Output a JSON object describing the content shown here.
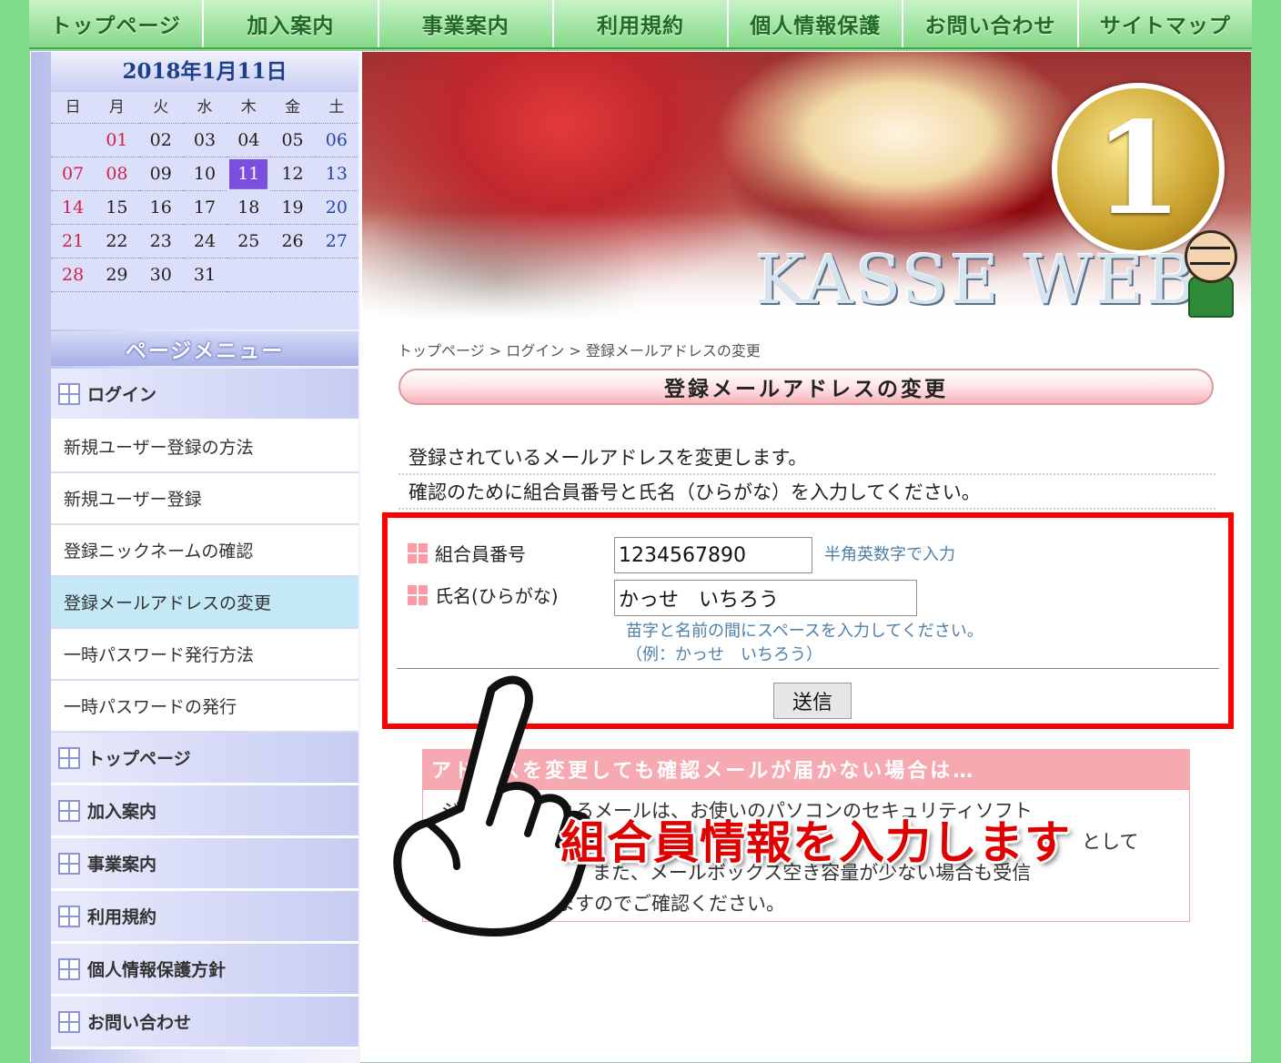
{
  "topnav": [
    "トップページ",
    "加入案内",
    "事業案内",
    "利用規約",
    "個人情報保護",
    "お問い合わせ",
    "サイトマップ"
  ],
  "calendar": {
    "title": "2018年1月11日",
    "weekdays": [
      "日",
      "月",
      "火",
      "水",
      "木",
      "金",
      "土"
    ],
    "days": [
      [
        "",
        "01",
        "02",
        "03",
        "04",
        "05",
        "06"
      ],
      [
        "07",
        "08",
        "09",
        "10",
        "11",
        "12",
        "13"
      ],
      [
        "14",
        "15",
        "16",
        "17",
        "18",
        "19",
        "20"
      ],
      [
        "21",
        "22",
        "23",
        "24",
        "25",
        "26",
        "27"
      ],
      [
        "28",
        "29",
        "30",
        "31",
        "",
        "",
        ""
      ]
    ],
    "holidays": [
      "01",
      "08"
    ],
    "today": "11"
  },
  "sidebar": {
    "menu_header": "ページメニュー",
    "items": [
      {
        "label": "ログイン",
        "type": "category"
      },
      {
        "label": "新規ユーザー登録の方法",
        "type": "sub"
      },
      {
        "label": "新規ユーザー登録",
        "type": "sub"
      },
      {
        "label": "登録ニックネームの確認",
        "type": "sub"
      },
      {
        "label": "登録メールアドレスの変更",
        "type": "sub",
        "active": true
      },
      {
        "label": "一時パスワード発行方法",
        "type": "sub"
      },
      {
        "label": "一時パスワードの発行",
        "type": "sub"
      },
      {
        "label": "トップページ",
        "type": "category"
      },
      {
        "label": "加入案内",
        "type": "category"
      },
      {
        "label": "事業案内",
        "type": "category"
      },
      {
        "label": "利用規約",
        "type": "category"
      },
      {
        "label": "個人情報保護方針",
        "type": "category"
      },
      {
        "label": "お問い合わせ",
        "type": "category"
      }
    ]
  },
  "banner": {
    "medal_text": "1",
    "brand": "KASSE WEB"
  },
  "breadcrumb": {
    "items": [
      "トップページ",
      "ログイン",
      "登録メールアドレスの変更"
    ],
    "separator": " > "
  },
  "page_title": "登録メールアドレスの変更",
  "intro": {
    "line1": "登録されているメールアドレスを変更します。",
    "line2": "確認のために組合員番号と氏名（ひらがな）を入力してください。"
  },
  "form": {
    "member_label": "組合員番号",
    "member_value": "1234567890",
    "member_hint": "半角英数字で入力",
    "name_label": "氏名(ひらがな)",
    "name_value": "かっせ　いちろう",
    "name_hint_1": "苗字と名前の間にスペースを入力してください。",
    "name_hint_2": "（例：かっせ　いちろう）",
    "submit_label": "送信"
  },
  "notice": {
    "header": "アドレスを変更しても確認メールが届かない場合は…",
    "line1": "ジから送信されるメールは、お使いのパソコンのセキュリティソフト",
    "line2": "として",
    "line3": "場合があります。また、メールボックス空き容量が少ない場合も受信",
    "line4": "い場合がありますのでご確認ください。"
  },
  "annotation": {
    "caption": "組合員情報を入力します"
  },
  "colors": {
    "accent_red": "#ff0000",
    "nav_green": "#1e6b22",
    "notice_pink": "#f7a9b2",
    "today_purple": "#7a4fe0"
  }
}
